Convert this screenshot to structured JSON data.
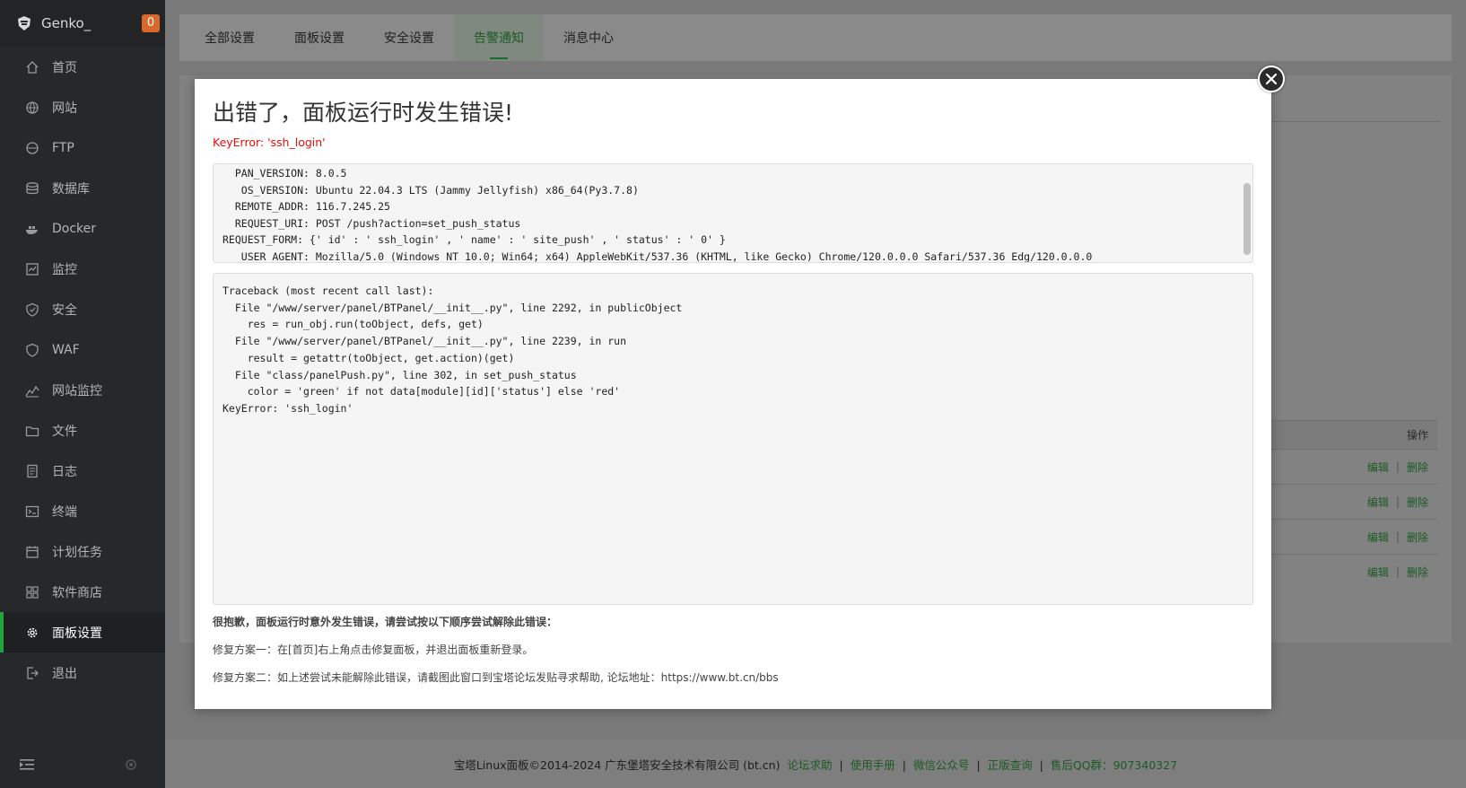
{
  "sidebar": {
    "brand": "Genko_",
    "badge": "0",
    "items": [
      {
        "label": "首页",
        "icon": "home-icon"
      },
      {
        "label": "网站",
        "icon": "globe-icon"
      },
      {
        "label": "FTP",
        "icon": "ftp-icon"
      },
      {
        "label": "数据库",
        "icon": "database-icon"
      },
      {
        "label": "Docker",
        "icon": "docker-icon"
      },
      {
        "label": "监控",
        "icon": "monitor-icon"
      },
      {
        "label": "安全",
        "icon": "shield-icon"
      },
      {
        "label": "WAF",
        "icon": "waf-shield-icon"
      },
      {
        "label": "网站监控",
        "icon": "chart-icon"
      },
      {
        "label": "文件",
        "icon": "folder-icon"
      },
      {
        "label": "日志",
        "icon": "log-icon"
      },
      {
        "label": "终端",
        "icon": "terminal-icon"
      },
      {
        "label": "计划任务",
        "icon": "calendar-icon"
      },
      {
        "label": "软件商店",
        "icon": "apps-icon"
      },
      {
        "label": "面板设置",
        "icon": "gear-icon"
      },
      {
        "label": "退出",
        "icon": "logout-icon"
      }
    ],
    "active_index": 14
  },
  "tabs": [
    "全部设置",
    "面板设置",
    "安全设置",
    "告警通知",
    "消息中心"
  ],
  "active_tab": 3,
  "background_table": {
    "header": "操作",
    "rows": [
      {
        "edit": "编辑",
        "delete": "删除"
      },
      {
        "edit": "编辑",
        "delete": "删除"
      },
      {
        "edit": "编辑",
        "delete": "删除"
      },
      {
        "edit": "编辑",
        "delete": "删除"
      }
    ]
  },
  "modal": {
    "title": "出错了，面板运行时发生错误!",
    "error": "KeyError: 'ssh_login'",
    "info_lines": [
      "  PAN_VERSION: 8.0.5",
      "   OS_VERSION: Ubuntu 22.04.3 LTS (Jammy Jellyfish) x86_64(Py3.7.8)",
      "  REMOTE_ADDR: 116.7.245.25",
      "  REQUEST_URI: POST /push?action=set_push_status",
      "REQUEST_FORM: {' id' : ' ssh_login' , ' name' : ' site_push' , ' status' : ' 0' }",
      "   USER_AGENT: Mozilla/5.0 (Windows NT 10.0; Win64; x64) AppleWebKit/537.36 (KHTML, like Gecko) Chrome/120.0.0.0 Safari/537.36 Edg/120.0.0.0"
    ],
    "traceback_lines": [
      "Traceback (most recent call last):",
      "  File \"/www/server/panel/BTPanel/__init__.py\", line 2292, in publicObject",
      "    res = run_obj.run(toObject, defs, get)",
      "  File \"/www/server/panel/BTPanel/__init__.py\", line 2239, in run",
      "    result = getattr(toObject, get.action)(get)",
      "  File \"class/panelPush.py\", line 302, in set_push_status",
      "    color = 'green' if not data[module][id]['status'] else 'red'",
      "KeyError: 'ssh_login'"
    ],
    "tip_title": "很抱歉，面板运行时意外发生错误，请尝试按以下顺序尝试解除此错误：",
    "tip1": "修复方案一：在[首页]右上角点击修复面板，并退出面板重新登录。",
    "tip2": "修复方案二：如上述尝试未能解除此错误，请截图此窗口到宝塔论坛发贴寻求帮助, 论坛地址：https://www.bt.cn/bbs"
  },
  "footer": {
    "copyright": "宝塔Linux面板©2014-2024 广东堡塔安全技术有限公司 (bt.cn)",
    "links": [
      "论坛求助",
      "使用手册",
      "微信公众号",
      "正版查询",
      "售后QQ群：907340327"
    ]
  },
  "colors": {
    "accent_green": "#20a53a",
    "error_red": "#e80c0c",
    "sidebar_bg": "#26292c",
    "badge": "#d9682d"
  }
}
